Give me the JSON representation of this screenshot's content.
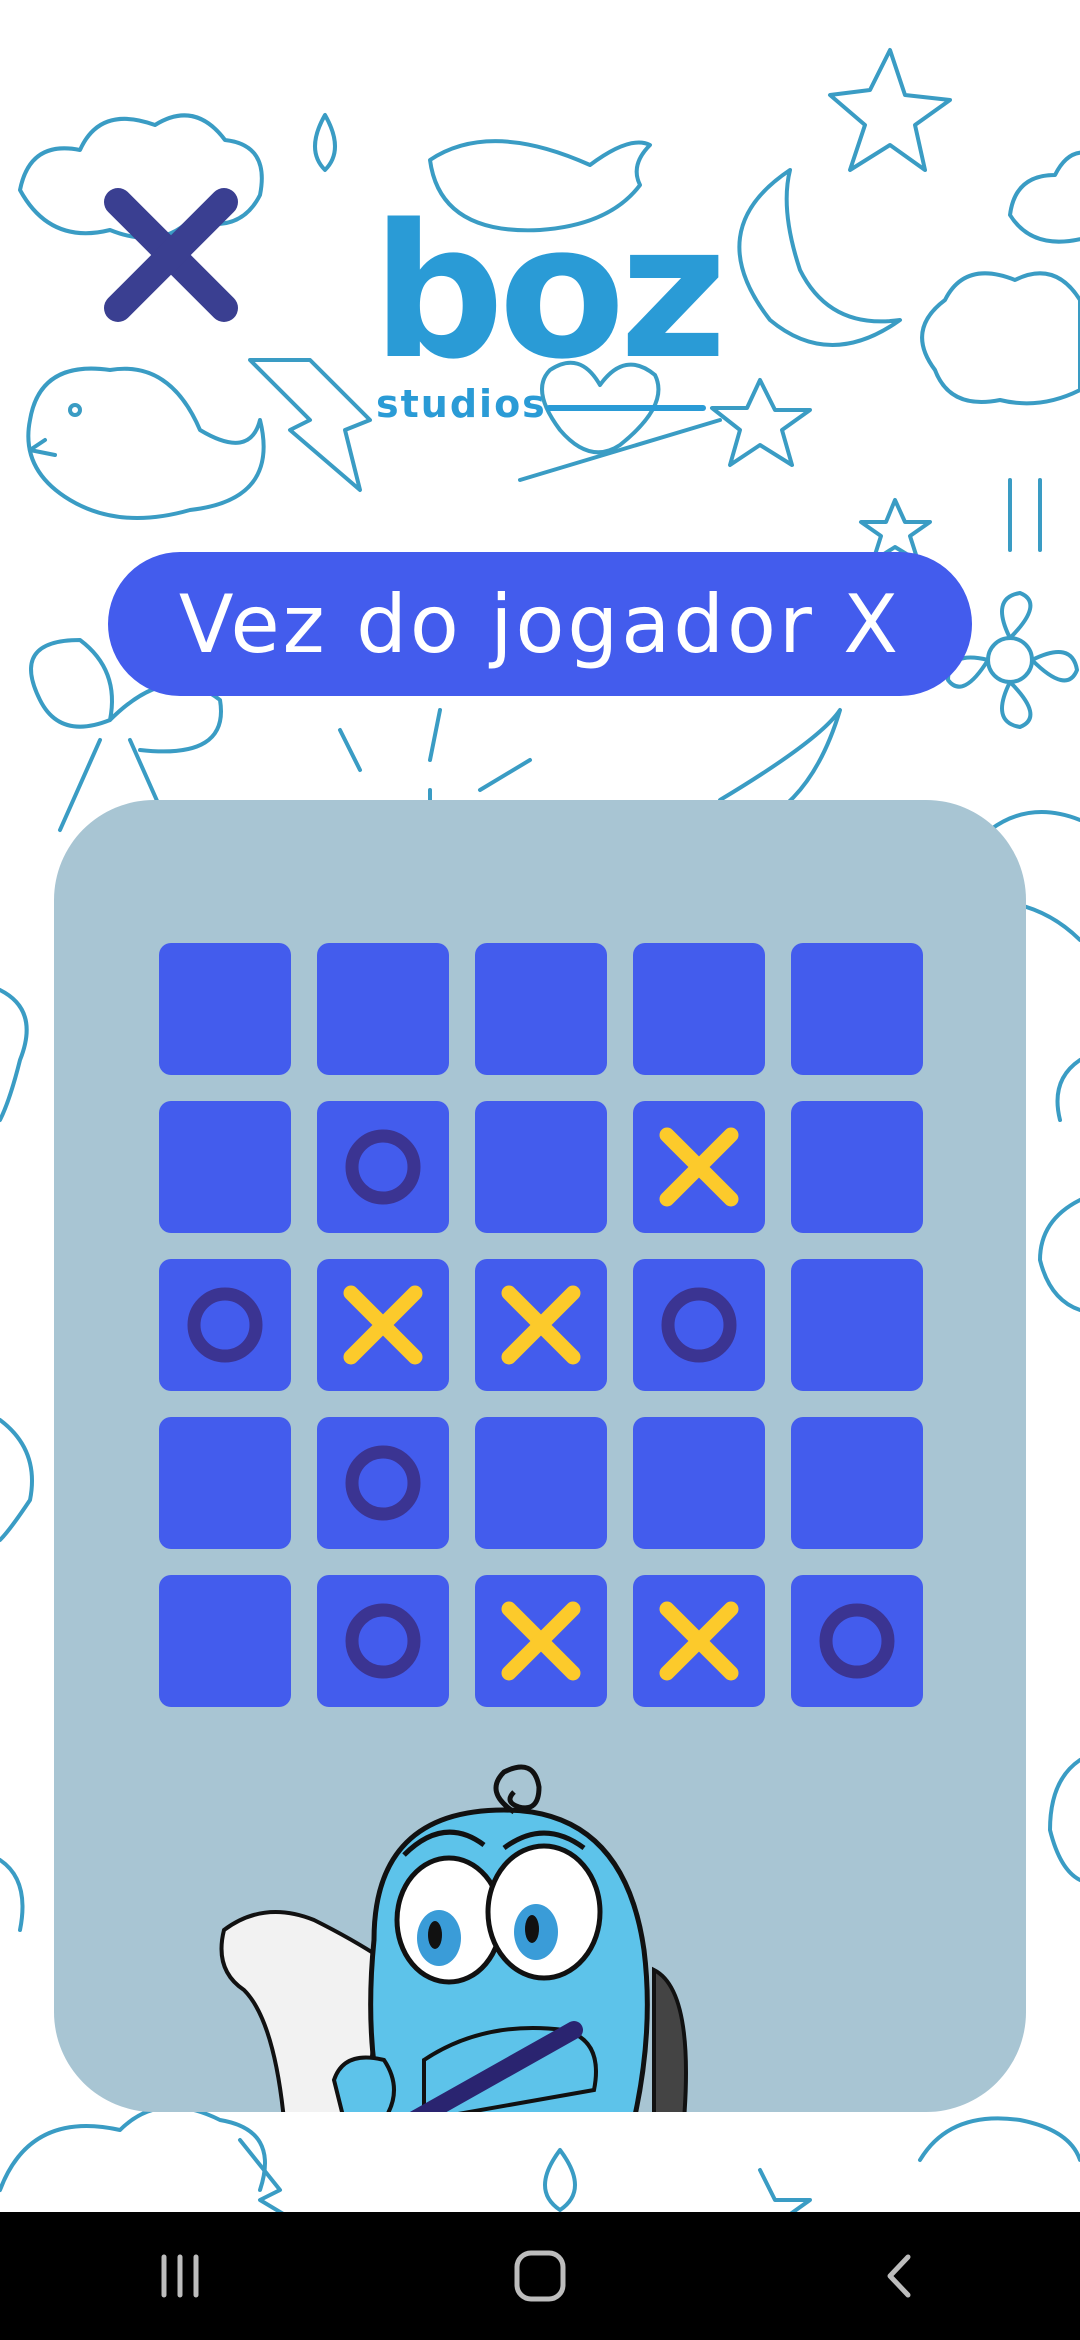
{
  "header": {
    "logo": {
      "main": "boz",
      "sub": "studios"
    }
  },
  "status": {
    "turn_text": "Vez do jogador X"
  },
  "board": {
    "size": 5,
    "cells": [
      [
        "",
        "",
        "",
        "",
        ""
      ],
      [
        "",
        "O",
        "",
        "X",
        ""
      ],
      [
        "O",
        "X",
        "X",
        "O",
        ""
      ],
      [
        "",
        "O",
        "",
        "",
        ""
      ],
      [
        "",
        "O",
        "X",
        "X",
        "O"
      ]
    ]
  },
  "colors": {
    "background": "#ffffff",
    "doodle": "#3a9cc4",
    "banner": "#435ced",
    "panel": "#a8c5d3",
    "cell": "#435ced",
    "x_mark": "#fcca2b",
    "o_mark": "#3b3492",
    "close_icon": "#3a3f91",
    "logo": "#2a9bd6"
  },
  "icons": {
    "close": "close-icon",
    "x_mark": "x-mark-icon",
    "o_mark": "o-mark-icon",
    "mascot": "mascot-character",
    "nav_recents": "recents-icon",
    "nav_home": "home-icon",
    "nav_back": "back-icon"
  }
}
